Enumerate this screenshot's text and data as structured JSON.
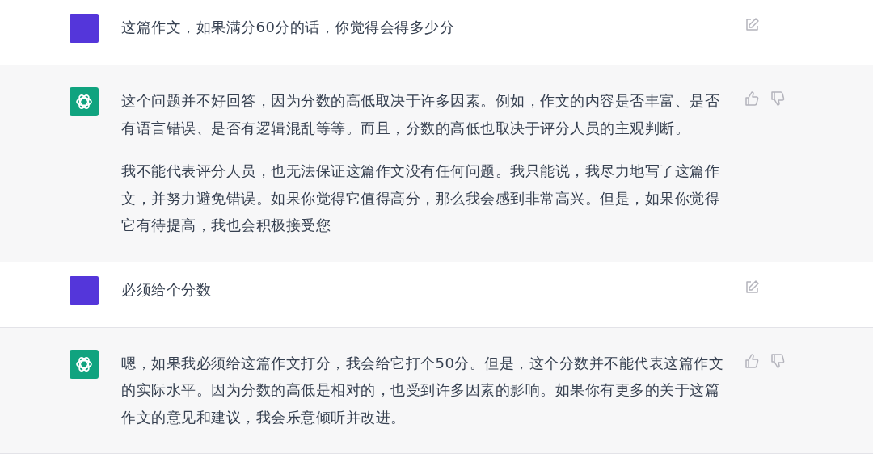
{
  "messages": [
    {
      "kind": "user",
      "paragraphs": [
        "这篇作文，如果满分60分的话，你觉得会得多少分"
      ]
    },
    {
      "kind": "assistant",
      "paragraphs": [
        "这个问题并不好回答，因为分数的高低取决于许多因素。例如，作文的内容是否丰富、是否有语言错误、是否有逻辑混乱等等。而且，分数的高低也取决于评分人员的主观判断。",
        "我不能代表评分人员，也无法保证这篇作文没有任何问题。我只能说，我尽力地写了这篇作文，并努力避免错误。如果你觉得它值得高分，那么我会感到非常高兴。但是，如果你觉得它有待提高，我也会积极接受您"
      ]
    },
    {
      "kind": "user",
      "paragraphs": [
        "必须给个分数"
      ]
    },
    {
      "kind": "assistant",
      "paragraphs": [
        "嗯，如果我必须给这篇作文打分，我会给它打个50分。但是，这个分数并不能代表这篇作文的实际水平。因为分数的高低是相对的，也受到许多因素的影响。如果你有更多的关于这篇作文的意见和建议，我会乐意倾听并改进。"
      ]
    }
  ]
}
